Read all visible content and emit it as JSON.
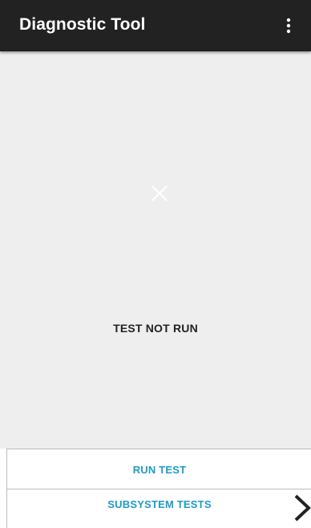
{
  "app_bar": {
    "title": "Diagnostic Tool",
    "overflow_icon": "more-vert-icon",
    "background": "#222222"
  },
  "main": {
    "status_icon": "close-icon",
    "status_text": "TEST NOT RUN",
    "background": "#eeeeee"
  },
  "actions": {
    "run_test_label": "RUN TEST",
    "subsystem_tests_label": "SUBSYSTEM TESTS",
    "subsystem_tests_icon": "chevron-right-icon",
    "accent": "#1e9bc9"
  }
}
